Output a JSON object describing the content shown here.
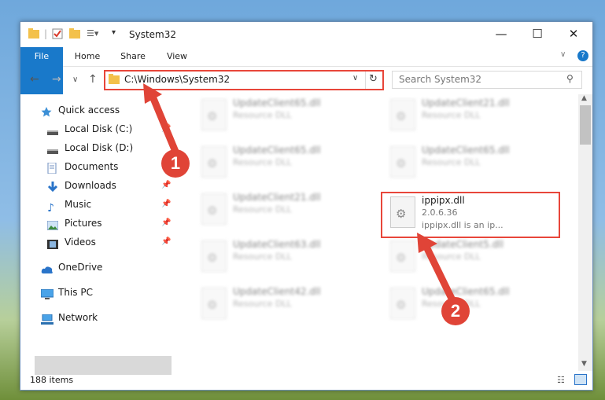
{
  "window": {
    "title": "System32"
  },
  "ribbon": {
    "file": "File",
    "home": "Home",
    "share": "Share",
    "view": "View"
  },
  "address": {
    "path": "C:\\Windows\\System32"
  },
  "search": {
    "placeholder": "Search System32"
  },
  "sidebar": {
    "items": [
      {
        "label": "Quick access"
      },
      {
        "label": "Local Disk (C:)"
      },
      {
        "label": "Local Disk (D:)"
      },
      {
        "label": "Documents"
      },
      {
        "label": "Downloads"
      },
      {
        "label": "Music"
      },
      {
        "label": "Pictures"
      },
      {
        "label": "Videos"
      },
      {
        "label": "OneDrive"
      },
      {
        "label": "This PC"
      },
      {
        "label": "Network"
      }
    ]
  },
  "files": [
    {
      "name": "UpdateClient65.dll",
      "desc": "Resource DLL"
    },
    {
      "name": "UpdateClient21.dll",
      "desc": "Resource DLL"
    },
    {
      "name": "UpdateClient65.dll",
      "desc": "Resource DLL"
    },
    {
      "name": "UpdateClient65.dll",
      "desc": "Resource DLL"
    },
    {
      "name": "UpdateClient21.dll",
      "desc": "Resource DLL"
    },
    {
      "name": "ippipx.dll",
      "version": "2.0.6.36",
      "desc": "ippipx.dll is an ip..."
    },
    {
      "name": "UpdateClient63.dll",
      "desc": "Resource DLL"
    },
    {
      "name": "UpdateClient5.dll",
      "desc": "Resource DLL"
    },
    {
      "name": "UpdateClient42.dll",
      "desc": "Resource DLL"
    },
    {
      "name": "UpdateClient65.dll",
      "desc": "Resource DLL"
    }
  ],
  "status": {
    "count": "188 items"
  },
  "annotations": {
    "step1": "1",
    "step2": "2",
    "color": "#e04437"
  }
}
